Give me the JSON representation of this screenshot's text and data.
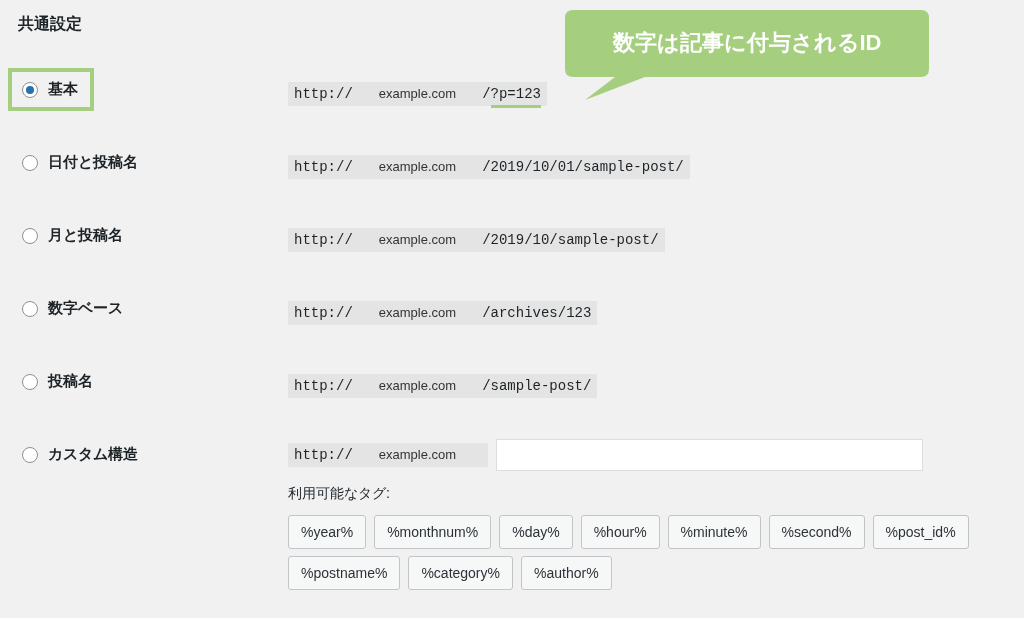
{
  "section_title": "共通設定",
  "callout": {
    "text": "数字は記事に付与されるID"
  },
  "options": [
    {
      "kind": "preset",
      "label": "基本",
      "selected": true,
      "highlighted": true,
      "scheme": "http://",
      "domain": "example.com",
      "path": "/",
      "path_marked": "?p=123"
    },
    {
      "kind": "preset",
      "label": "日付と投稿名",
      "selected": false,
      "highlighted": false,
      "scheme": "http://",
      "domain": "example.com",
      "path": "/2019/10/01/sample-post/"
    },
    {
      "kind": "preset",
      "label": "月と投稿名",
      "selected": false,
      "highlighted": false,
      "scheme": "http://",
      "domain": "example.com",
      "path": "/2019/10/sample-post/"
    },
    {
      "kind": "preset",
      "label": "数字ベース",
      "selected": false,
      "highlighted": false,
      "scheme": "http://",
      "domain": "example.com",
      "path": "/archives/123"
    },
    {
      "kind": "preset",
      "label": "投稿名",
      "selected": false,
      "highlighted": false,
      "scheme": "http://",
      "domain": "example.com",
      "path": "/sample-post/"
    },
    {
      "kind": "custom",
      "label": "カスタム構造",
      "selected": false,
      "highlighted": false,
      "scheme": "http://",
      "domain": "example.com",
      "tags_label": "利用可能なタグ:",
      "tags": [
        "%year%",
        "%monthnum%",
        "%day%",
        "%hour%",
        "%minute%",
        "%second%",
        "%post_id%",
        "%postname%",
        "%category%",
        "%author%"
      ]
    }
  ]
}
